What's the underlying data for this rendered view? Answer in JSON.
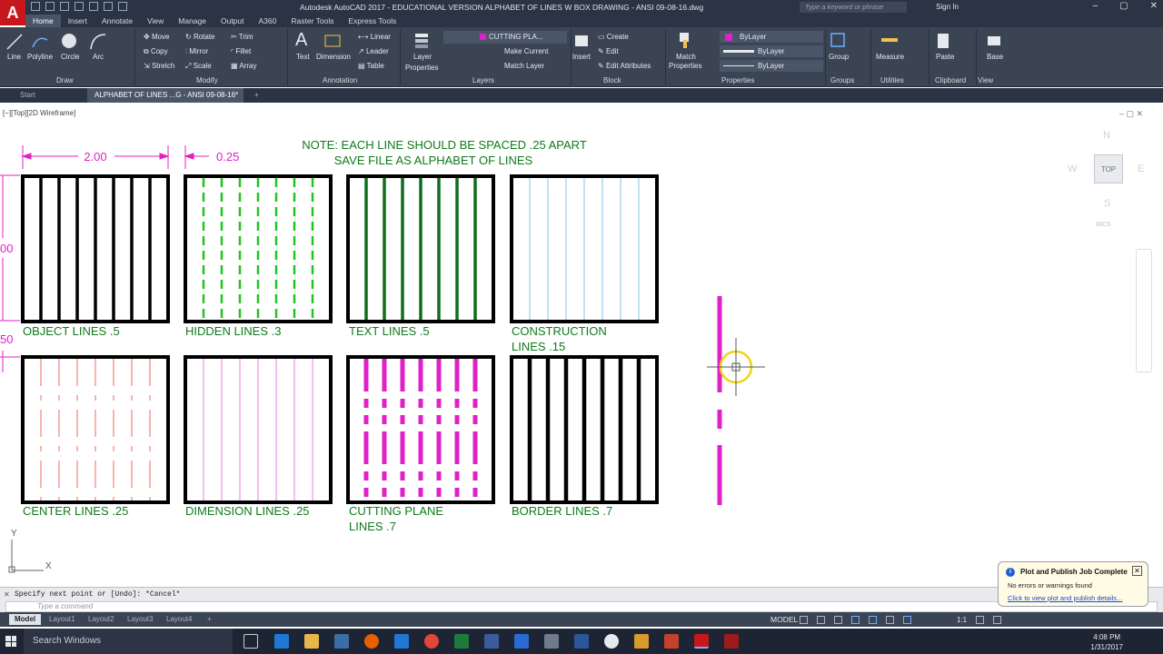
{
  "app": {
    "logo": "A",
    "window_title": "Autodesk AutoCAD 2017 - EDUCATIONAL VERSION   ALPHABET OF LINES W BOX DRAWING - ANSI 09-08-16.dwg",
    "search_placeholder": "Type a keyword or phrase",
    "sign_in": "Sign In"
  },
  "ribbon_tabs": [
    "Home",
    "Insert",
    "Annotate",
    "View",
    "Manage",
    "Output",
    "A360",
    "Raster Tools",
    "Express Tools"
  ],
  "ribbon": {
    "draw": {
      "line": "Line",
      "polyline": "Polyline",
      "circle": "Circle",
      "arc": "Arc",
      "label": "Draw"
    },
    "modify": {
      "move": "Move",
      "rotate": "Rotate",
      "trim": "Trim",
      "copy": "Copy",
      "mirror": "Mirror",
      "fillet": "Fillet",
      "stretch": "Stretch",
      "scale": "Scale",
      "array": "Array",
      "label": "Modify"
    },
    "annotation": {
      "text": "Text",
      "dimension": "Dimension",
      "linear": "Linear",
      "leader": "Leader",
      "table": "Table",
      "label": "Annotation"
    },
    "layers": {
      "layer_properties_1": "Layer",
      "layer_properties_2": "Properties",
      "current_layer": "CUTTING PLA...",
      "make_current": "Make Current",
      "match_layer": "Match Layer",
      "label": "Layers"
    },
    "block": {
      "insert": "Insert",
      "create": "Create",
      "edit": "Edit",
      "edit_attributes": "Edit Attributes",
      "label": "Block"
    },
    "properties": {
      "match_1": "Match",
      "match_2": "Properties",
      "bylayer_color": "ByLayer",
      "bylayer_lineweight": "ByLayer",
      "bylayer_linetype": "ByLayer",
      "label": "Properties"
    },
    "groups": {
      "group": "Group",
      "label": "Groups"
    },
    "utilities": {
      "measure": "Measure",
      "label": "Utilities"
    },
    "clipboard": {
      "paste": "Paste",
      "label": "Clipboard"
    },
    "view": {
      "base": "Base",
      "label": "View"
    }
  },
  "file_tabs": {
    "start": "Start",
    "active": "ALPHABET OF LINES ...G - ANSI 09-08-16*"
  },
  "viewport_label": "[−][Top][2D Wireframe]",
  "viewcube": {
    "top": "TOP",
    "n": "N",
    "s": "S",
    "e": "E",
    "w": "W",
    "wcs": "WCS"
  },
  "drawing": {
    "note_line1": "NOTE: EACH LINE SHOULD BE  SPACED .25 APART",
    "note_line2": "SAVE FILE AS ALPHABET OF LINES",
    "dim_width": "2.00",
    "dim_spacing": "0.25",
    "dim_height": "00",
    "dim_gap": "50",
    "labels": {
      "object": "OBJECT LINES .5",
      "hidden": "HIDDEN LINES .3",
      "text": "TEXT LINES .5",
      "construction_1": "CONSTRUCTION",
      "construction_2": "LINES  .15",
      "center": "CENTER LINES .25",
      "dimension": "DIMENSION LINES .25",
      "cutting_1": "CUTTING PLANE",
      "cutting_2": "LINES .7",
      "border": "BORDER LINES  .7"
    },
    "ucs_x": "X",
    "ucs_y": "Y",
    "colors": {
      "green": "#0f7a1b",
      "magenta": "#e020c8",
      "hidden_green": "#22c41f",
      "construction_blue": "#7fc6ef",
      "center_red": "#f06a55",
      "dimension_pink": "#e77ee0",
      "cursor_yellow": "#f0d21c"
    }
  },
  "command": {
    "history": "Specify next point or [Undo]: *Cancel*",
    "placeholder": "Type a command"
  },
  "layout_tabs": [
    "Model",
    "Layout1",
    "Layout2",
    "Layout3",
    "Layout4"
  ],
  "status": {
    "model": "MODEL",
    "scale": "1:1"
  },
  "toast": {
    "title": "Plot and Publish Job Complete",
    "message": "No errors or warnings found",
    "link": "Click to view plot and publish details..."
  },
  "taskbar": {
    "search": "Search Windows",
    "time": "4:08 PM",
    "date": "1/31/2017"
  }
}
